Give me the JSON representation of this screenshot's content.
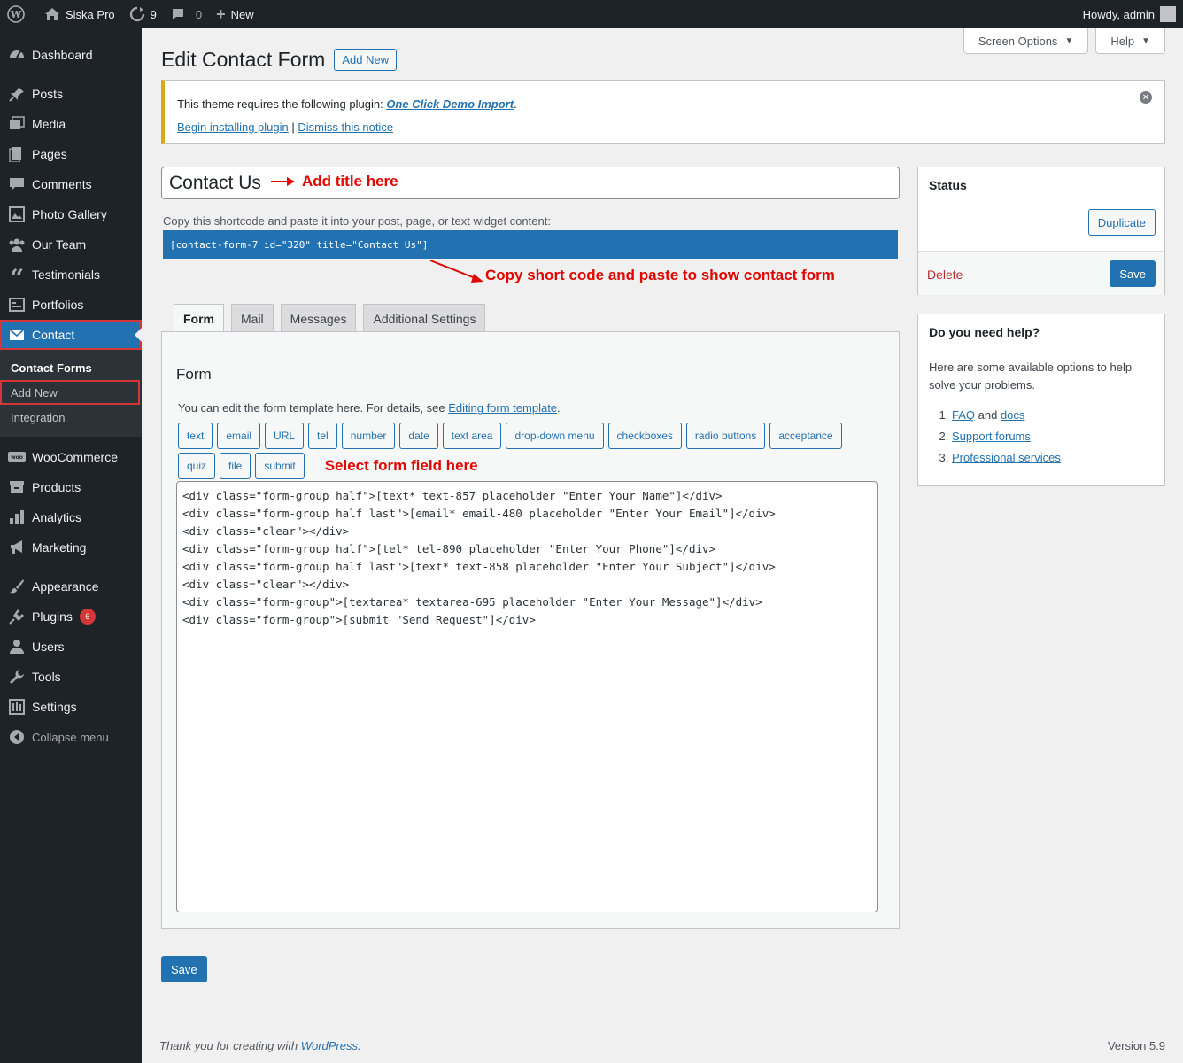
{
  "adminbar": {
    "site_name": "Siska Pro",
    "updates_count": "9",
    "comments_count": "0",
    "new_label": "New",
    "howdy": "Howdy, admin"
  },
  "sidebar": {
    "items": [
      {
        "label": "Dashboard",
        "icon": "dashboard-icon"
      },
      {
        "label": "Posts",
        "icon": "pin-icon"
      },
      {
        "label": "Media",
        "icon": "media-icon"
      },
      {
        "label": "Pages",
        "icon": "pages-icon"
      },
      {
        "label": "Comments",
        "icon": "comment-icon"
      },
      {
        "label": "Photo Gallery",
        "icon": "gallery-icon"
      },
      {
        "label": "Our Team",
        "icon": "team-icon"
      },
      {
        "label": "Testimonials",
        "icon": "quote-icon"
      },
      {
        "label": "Portfolios",
        "icon": "portfolio-icon"
      },
      {
        "label": "Contact",
        "icon": "mail-icon"
      },
      {
        "label": "WooCommerce",
        "icon": "woo-icon"
      },
      {
        "label": "Products",
        "icon": "archive-icon"
      },
      {
        "label": "Analytics",
        "icon": "chart-icon"
      },
      {
        "label": "Marketing",
        "icon": "megaphone-icon"
      },
      {
        "label": "Appearance",
        "icon": "brush-icon"
      },
      {
        "label": "Plugins",
        "icon": "plugin-icon",
        "badge": "6"
      },
      {
        "label": "Users",
        "icon": "user-icon"
      },
      {
        "label": "Tools",
        "icon": "wrench-icon"
      },
      {
        "label": "Settings",
        "icon": "settings-icon"
      },
      {
        "label": "Collapse menu",
        "icon": "collapse-icon"
      }
    ],
    "submenu": [
      "Contact Forms",
      "Add New",
      "Integration"
    ]
  },
  "header": {
    "title": "Edit Contact Form",
    "add_new": "Add New",
    "screen_options": "Screen Options",
    "help": "Help"
  },
  "notice": {
    "text": "This theme requires the following plugin:",
    "plugin": "One Click Demo Import",
    "begin": "Begin installing plugin",
    "sep": "|",
    "dismiss": "Dismiss this notice"
  },
  "form": {
    "title_value": "Contact Us",
    "annot_title": "Add title here",
    "shortcode_label": "Copy this shortcode and paste it into your post, page, or text widget content:",
    "shortcode": "[contact-form-7 id=\"320\" title=\"Contact Us\"]",
    "annot_shortcode": "Copy short code and paste to show contact form",
    "tabs": [
      "Form",
      "Mail",
      "Messages",
      "Additional Settings"
    ],
    "panel_heading": "Form",
    "help_text": "You can edit the form template here. For details, see ",
    "help_link": "Editing form template",
    "tag_buttons": [
      "text",
      "email",
      "URL",
      "tel",
      "number",
      "date",
      "text area",
      "drop-down menu",
      "checkboxes",
      "radio buttons",
      "acceptance",
      "quiz",
      "file",
      "submit"
    ],
    "annot_field": "Select form field here",
    "code": "<div class=\"form-group half\">[text* text-857 placeholder \"Enter Your Name\"]</div>\n<div class=\"form-group half last\">[email* email-480 placeholder \"Enter Your Email\"]</div>\n<div class=\"clear\"></div>\n<div class=\"form-group half\">[tel* tel-890 placeholder \"Enter Your Phone\"]</div>\n<div class=\"form-group half last\">[text* text-858 placeholder \"Enter Your Subject\"]</div>\n<div class=\"clear\"></div>\n<div class=\"form-group\">[textarea* textarea-695 placeholder \"Enter Your Message\"]</div>\n<div class=\"form-group\">[submit \"Send Request\"]</div>",
    "save": "Save"
  },
  "status_box": {
    "heading": "Status",
    "duplicate": "Duplicate",
    "delete": "Delete",
    "save": "Save"
  },
  "help_box": {
    "heading": "Do you need help?",
    "desc": "Here are some available options to help solve your problems.",
    "faq": "FAQ",
    "and": " and ",
    "docs": "docs",
    "support": "Support forums",
    "professional": "Professional services"
  },
  "footer": {
    "thanks": "Thank you for creating with ",
    "wp_link": "WordPress",
    "version": "Version 5.9"
  },
  "colors": {
    "accent": "#2271b1",
    "admin_bg": "#1d2327",
    "annotation": "#e10600",
    "notice_border": "#dba617"
  }
}
